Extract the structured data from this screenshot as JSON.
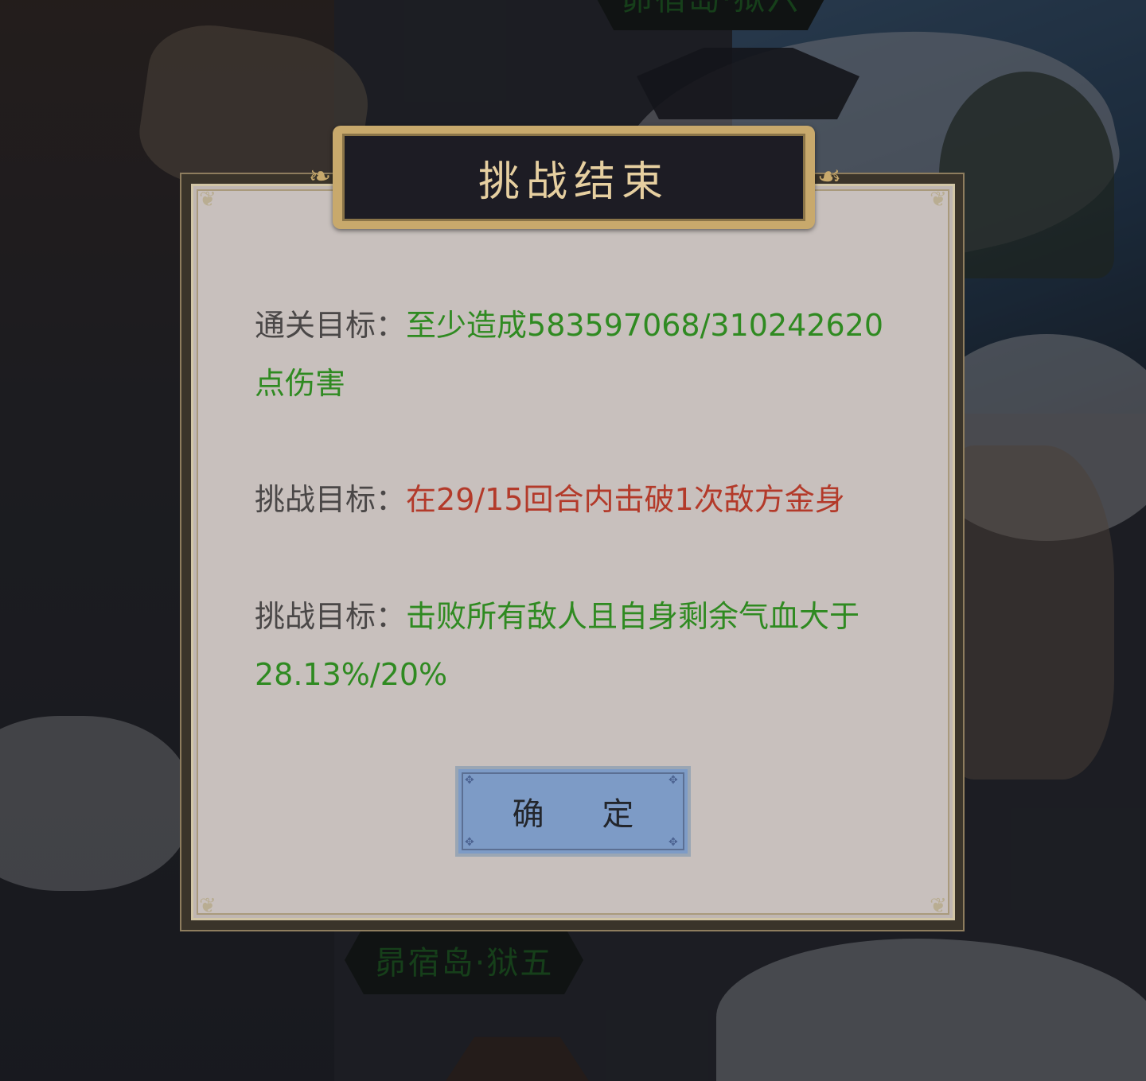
{
  "stage_labels": {
    "top": "昴宿岛·狱六",
    "bottom": "昴宿岛·狱五"
  },
  "dialog": {
    "title": "挑战结束",
    "goals": [
      {
        "label": "通关目标：",
        "text": "至少造成583597068/310242620点伤害",
        "status": "complete"
      },
      {
        "label": "挑战目标：",
        "text": "在29/15回合内击破1次敌方金身",
        "status": "failed"
      },
      {
        "label": "挑战目标：",
        "text": "击败所有敌人且自身剩余气血大于28.13%/20%",
        "status": "complete"
      }
    ],
    "confirm_label": "确 定"
  },
  "colors": {
    "complete": "#2f8a21",
    "failed": "#b33a2a",
    "label": "#4a4747",
    "title": "#e6cfa0",
    "button": "#7d9bc6"
  }
}
